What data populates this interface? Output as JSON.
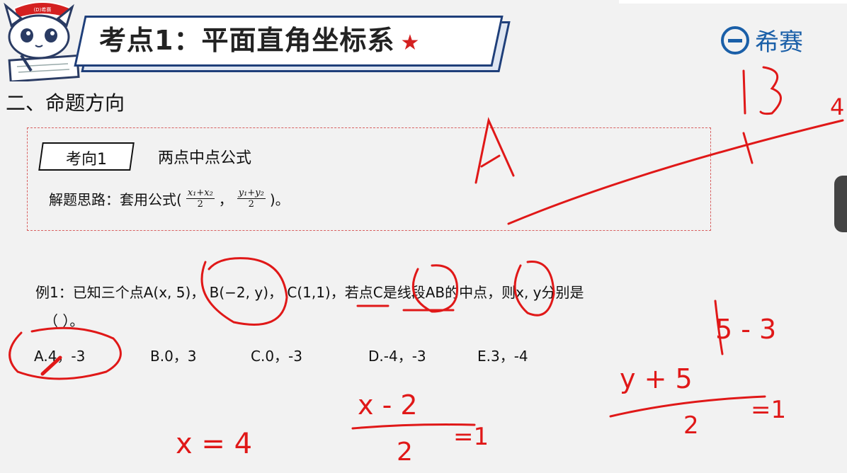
{
  "header": {
    "title": "考点1：平面直角坐标系",
    "star": "★",
    "brand": "希赛",
    "mascot_label": "(D)希赛"
  },
  "section_heading": "二、命题方向",
  "topic_box": {
    "tag": "考向1",
    "title": "两点中点公式",
    "tip_prefix": "解题思路：套用公式(",
    "frac1_num": "x₁+x₂",
    "frac1_den": "2",
    "separator": "，",
    "frac2_num": "y₁+y₂",
    "frac2_den": "2",
    "tip_suffix": ")。"
  },
  "question": {
    "line1": "例1：已知三个点A(x, 5)，  B(−2, y)，  C(1,1)，若点C是线段AB的中点，则x, y分别是",
    "line2": "（    ）。"
  },
  "options": [
    {
      "label": "A.4，-3"
    },
    {
      "label": "B.0，3"
    },
    {
      "label": "C.0，-3"
    },
    {
      "label": "D.-4，-3"
    },
    {
      "label": "E.3，-4"
    }
  ],
  "annotations": {
    "color": "#e01818",
    "a_label": "A",
    "b_label": "B",
    "four": "4",
    "x_num": "x - 2",
    "x_den": "2",
    "x_eq": "=1",
    "x_result": "x = 4",
    "y_num": "y + 5",
    "y_den": "2",
    "y_eq": "=1",
    "y_result": "5 - 3"
  },
  "colors": {
    "title_border": "#1f3f7a",
    "brand": "#1a5fa8",
    "dashed_border": "#d86060",
    "star": "#d42020"
  }
}
